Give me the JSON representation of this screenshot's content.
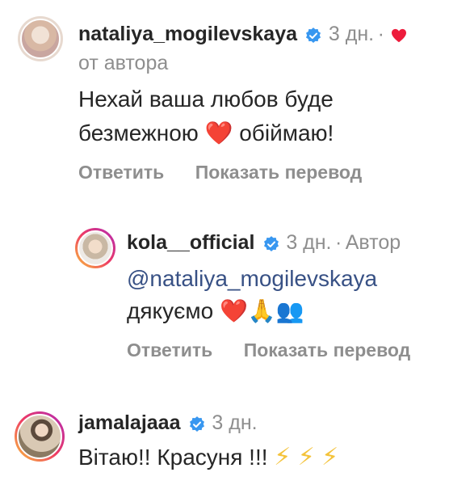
{
  "comments": [
    {
      "username": "nataliya_mogilevskaya",
      "time": "3 дн.",
      "separator": "·",
      "liked_icon": "heart-filled-icon",
      "author_tag": "от автора",
      "text_line1": "Нехай ваша любов буде",
      "text_line2a": "безмежною",
      "emoji_heart": "❤️",
      "text_line2b": "обіймаю!",
      "reply_label": "Ответить",
      "translate_label": "Показать перевод"
    },
    {
      "username": "kola__official",
      "time": "3 дн.",
      "separator": "·",
      "author_tag": "Автор",
      "mention": "@nataliya_mogilevskaya",
      "text": "дякуємо",
      "emojis": "❤️🙏👥",
      "reply_label": "Ответить",
      "translate_label": "Показать перевод"
    },
    {
      "username": "jamalajaaa",
      "time": "3 дн.",
      "text": "Вітаю!! Красуня !!!",
      "emojis": "⚡ ⚡ ⚡"
    }
  ],
  "colors": {
    "verified": "#3897f0",
    "like": "#ed1c3c",
    "muted": "#8e8e8e",
    "mention": "#385185"
  }
}
